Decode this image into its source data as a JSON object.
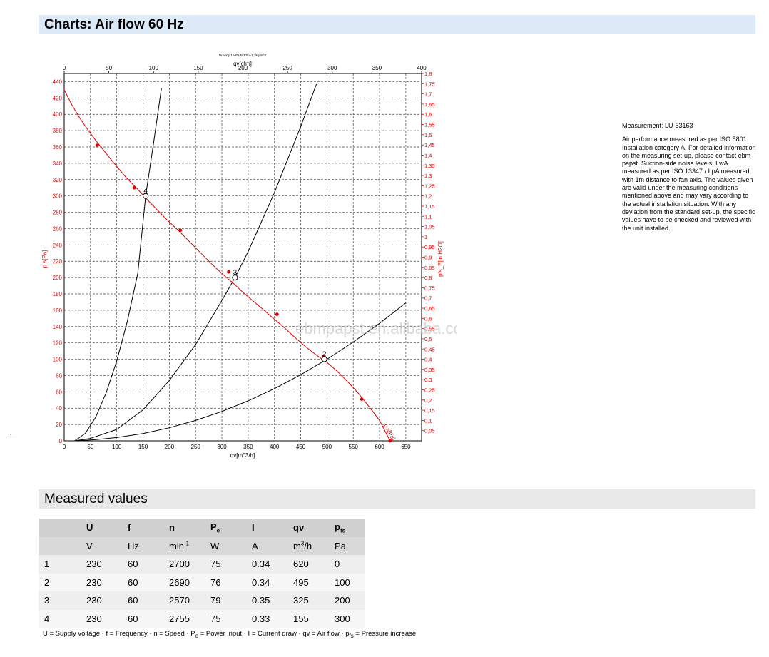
{
  "headers": {
    "chart": "Charts: Air flow 60 Hz",
    "measured": "Measured values"
  },
  "side_note": {
    "measurement": "Measurement: LU-53163",
    "text": "Air performance measured as per ISO 5801 Installation category A. For detailed information on the measuring set-up, please contact ebm-papst. Suction-side noise levels: LwA measured as per ISO 13347 / LpA measured with 1m distance to fan axis. The values given are valid under the measuring conditions mentioned above and may vary according to the actual installation situation. With any deviation from the standard set-up, the specific values have to be checked and reviewed with the unit installed."
  },
  "chart_data": {
    "type": "line",
    "caption": "Druck p f.a[Pa]bi Rho=1,2kg/m^3",
    "watermark": "ebmpapst.en.alibaba.com",
    "xlabel": "qv[m^3/h]",
    "xlabel_top": "qv[cfm]",
    "ylabel": "p s[Pa]",
    "ylabel_right": "pfs_E[in H2O]",
    "xlim": [
      0,
      680
    ],
    "ylim": [
      0,
      450
    ],
    "xlim_top": [
      0,
      400
    ],
    "ylim_right": [
      0,
      1.8
    ],
    "x_ticks": [
      "0",
      "50",
      "100",
      "150",
      "200",
      "250",
      "300",
      "350",
      "400",
      "450",
      "500",
      "550",
      "600",
      "650"
    ],
    "x_top_ticks": [
      "0",
      "50",
      "100",
      "150",
      "200",
      "250",
      "300",
      "350",
      "400"
    ],
    "y_ticks": [
      "0",
      "20",
      "40",
      "60",
      "80",
      "100",
      "120",
      "140",
      "160",
      "180",
      "200",
      "220",
      "240",
      "260",
      "280",
      "300",
      "320",
      "340",
      "360",
      "380",
      "400",
      "420",
      "440"
    ],
    "y_right_ticks": [
      "0,05",
      "0,1",
      "0,15",
      "0,2",
      "0,25",
      "0,3",
      "0,35",
      "0,4",
      "0,45",
      "0,5",
      "0,55",
      "0,6",
      "0,65",
      "0,7",
      "0,75",
      "0,8",
      "0,85",
      "0,9",
      "0,95",
      "1",
      "1,05",
      "1,1",
      "1,15",
      "1,2",
      "1,25",
      "1,3",
      "1,35",
      "1,4",
      "1,45",
      "1,5",
      "1,55",
      "1,6",
      "1,65",
      "1,7",
      "1,75",
      "1,8"
    ],
    "curve_label": "p s[Pa]",
    "series": [
      {
        "color": "#e00000",
        "x": [
          0,
          15,
          30,
          45,
          60,
          80,
          100,
          120,
          140,
          160,
          180,
          200,
          220,
          240,
          260,
          280,
          300,
          320,
          340,
          360,
          380,
          400,
          420,
          440,
          460,
          480,
          500,
          520,
          540,
          560,
          580,
          600,
          620
        ],
        "y": [
          430,
          411,
          395,
          381,
          368,
          352,
          336,
          321,
          308,
          294,
          281,
          268,
          256,
          243,
          230,
          217,
          205,
          194,
          182,
          171,
          160,
          149,
          138,
          126,
          115,
          105,
          96,
          85,
          72,
          58,
          42,
          25,
          0
        ],
        "markers": [
          [
            63,
            362
          ],
          [
            133,
            310
          ],
          [
            221,
            258
          ],
          [
            313,
            207
          ],
          [
            405,
            155
          ],
          [
            494,
            104
          ],
          [
            566,
            51
          ],
          [
            620,
            0
          ]
        ]
      },
      {
        "color": "#000000",
        "x": [
          20,
          60,
          100,
          150,
          200,
          250,
          300,
          350,
          400,
          450,
          500,
          550,
          600,
          650
        ],
        "y": [
          0,
          1.5,
          4,
          9,
          16,
          25,
          36,
          49,
          64,
          81,
          100,
          121,
          144,
          169
        ]
      },
      {
        "color": "#000000",
        "x": [
          20,
          50,
          100,
          150,
          200,
          250,
          300,
          325,
          350,
          400,
          450,
          480
        ],
        "y": [
          0,
          3,
          14,
          38,
          74,
          118,
          172,
          200,
          232,
          304,
          385,
          437
        ]
      },
      {
        "color": "#000000",
        "x": [
          20,
          40,
          60,
          80,
          100,
          120,
          140,
          155,
          170,
          185
        ],
        "y": [
          0,
          9,
          29,
          59,
          98,
          146,
          205,
          300,
          365,
          432
        ]
      }
    ],
    "operating_points": [
      {
        "label": "2",
        "x": 495,
        "y": 100
      },
      {
        "label": "3",
        "x": 325,
        "y": 200
      },
      {
        "label": "4",
        "x": 155,
        "y": 300
      }
    ],
    "grid": true
  },
  "table": {
    "head": [
      "",
      "U",
      "f",
      "n",
      "P_e",
      "I",
      "qv",
      "p_fs"
    ],
    "units": [
      "",
      "V",
      "Hz",
      "min-1",
      "W",
      "A",
      "m3/h",
      "Pa"
    ],
    "rows": [
      [
        "1",
        "230",
        "60",
        "2700",
        "75",
        "0.34",
        "620",
        "0"
      ],
      [
        "2",
        "230",
        "60",
        "2690",
        "76",
        "0.34",
        "495",
        "100"
      ],
      [
        "3",
        "230",
        "60",
        "2570",
        "79",
        "0.35",
        "325",
        "200"
      ],
      [
        "4",
        "230",
        "60",
        "2755",
        "75",
        "0.33",
        "155",
        "300"
      ]
    ]
  },
  "legend_line": "U = Supply voltage · f = Frequency · n = Speed · Pe = Power input · I = Current draw · qv = Air flow · pfs = Pressure increase"
}
